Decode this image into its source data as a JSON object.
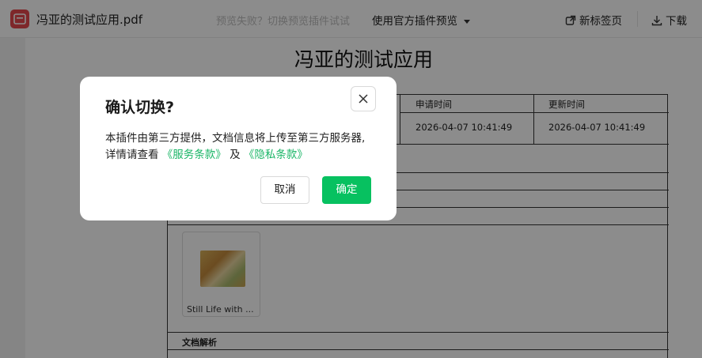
{
  "header": {
    "file_name": "冯亚的测试应用.pdf",
    "hint": "预览失败？切换预览插件试试",
    "plugin_select": "使用官方插件预览",
    "new_tab": "新标签页",
    "download": "下载"
  },
  "document": {
    "title": "冯亚的测试应用",
    "columns": [
      "申请时间",
      "更新时间"
    ],
    "row_values": [
      "2026-04-07 10:41:49",
      "2026-04-07 10:41:49"
    ],
    "thumbnail_caption": "Still Life with ...",
    "section_label": "文档解析"
  },
  "dialog": {
    "title": "确认切换?",
    "body_prefix": "本插件由第三方提供，文档信息将上传至第三方服务器,详情请查看",
    "link_terms": "《服务条款》",
    "conjunction": "及",
    "link_privacy": "《隐私条款》",
    "cancel_label": "取消",
    "confirm_label": "确定"
  },
  "colors": {
    "accent": "#07c160",
    "link": "#19b566",
    "file_icon": "#e5484d"
  }
}
